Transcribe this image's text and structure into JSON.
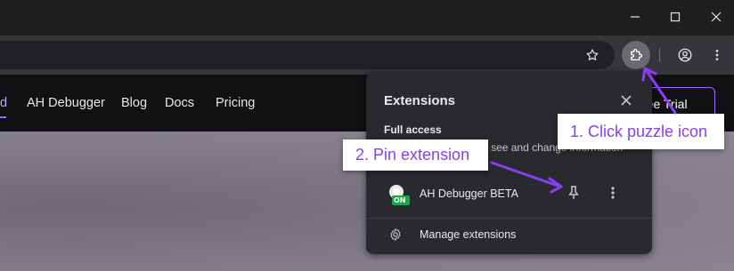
{
  "window": {
    "minimize_icon": "minimize-icon",
    "maximize_icon": "maximize-icon",
    "close_icon": "close-icon"
  },
  "toolbar": {
    "icons": [
      "star-icon",
      "puzzle-extensions-icon",
      "profile-icon",
      "kebab-menu-icon"
    ]
  },
  "site": {
    "nav_partial": "d",
    "nav_links": [
      "AH Debugger",
      "Blog",
      "Docs",
      "Pricing"
    ],
    "cta_label": "ree Trial",
    "accent_color": "#a463ff"
  },
  "popup": {
    "title": "Extensions",
    "section_title": "Full access",
    "section_desc": "These extensions can see and change information",
    "extension": {
      "name": "AH Debugger BETA",
      "badge": "ON",
      "badge_color": "#1fa34a"
    },
    "manage_label": "Manage extensions"
  },
  "annotations": {
    "step1": "1. Click puzzle icon",
    "step2": "2. Pin extension",
    "color": "#8a3df5"
  }
}
